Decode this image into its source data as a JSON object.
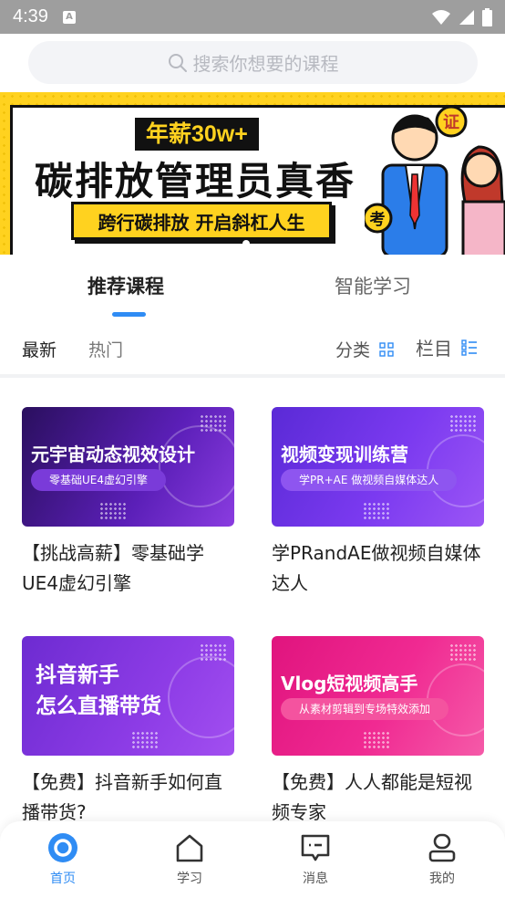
{
  "status": {
    "time": "4:39",
    "notification_icon": "a-icon"
  },
  "search": {
    "placeholder": "搜索你想要的课程"
  },
  "banner": {
    "salary_tag": "年薪30w+",
    "headline": "碳排放管理员真香",
    "ribbon": "跨行碳排放 开启斜杠人生",
    "badge_left": "考",
    "badge_right": "证"
  },
  "tabs": [
    {
      "label": "推荐课程"
    },
    {
      "label": "智能学习"
    }
  ],
  "filters": {
    "latest": "最新",
    "hot": "热门",
    "category": "分类",
    "column": "栏目"
  },
  "courses": [
    {
      "thumb_title": "元宇宙动态视效设计",
      "thumb_sub": "零基础UE4虚幻引擎",
      "title": "【挑战高薪】零基础学UE4虚幻引擎"
    },
    {
      "thumb_title": "视频变现训练营",
      "thumb_sub": "学PR+AE 做视频自媒体达人",
      "title": "学PRandAE做视频自媒体达人"
    },
    {
      "thumb_title_1": "抖音新手",
      "thumb_title_2": "怎么直播带货",
      "title": "【免费】抖音新手如何直播带货?"
    },
    {
      "thumb_title": "Vlog短视频高手",
      "thumb_sub": "从素材剪辑到专场特效添加",
      "title": "【免费】人人都能是短视频专家"
    }
  ],
  "nav": [
    {
      "label": "首页",
      "icon": "home-circle-icon"
    },
    {
      "label": "学习",
      "icon": "house-icon"
    },
    {
      "label": "消息",
      "icon": "message-icon"
    },
    {
      "label": "我的",
      "icon": "profile-icon"
    }
  ],
  "colors": {
    "accent": "#2f8cf4",
    "banner_yellow": "#ffd21f"
  }
}
